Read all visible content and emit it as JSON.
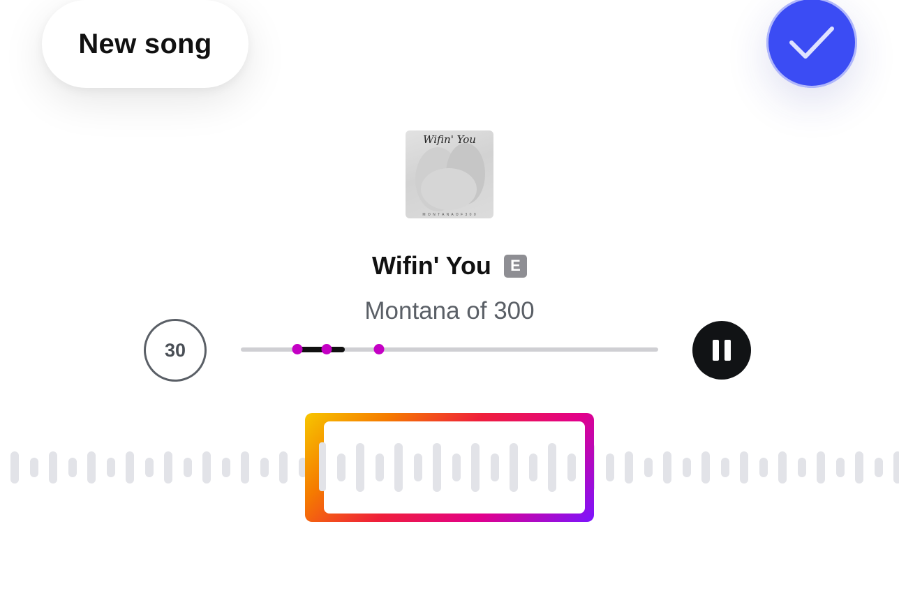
{
  "header": {
    "new_song_label": "New song",
    "done_icon": "checkmark-icon",
    "accent_color": "#3b4cf4"
  },
  "album": {
    "art_title": "Wifin' You",
    "art_credit": "M O N T A N A   O F   3 0 0"
  },
  "song": {
    "title": "Wifin' You",
    "explicit_badge": "E",
    "artist": "Montana of 300"
  },
  "player": {
    "duration_label": "30",
    "playback_state": "playing",
    "pause_icon": "pause-icon",
    "progress": {
      "selection_start_fraction": 0.135,
      "selection_end_fraction": 0.25,
      "markers_fraction": [
        0.135,
        0.205,
        0.331
      ]
    },
    "marker_color": "#c400c4"
  },
  "trimmer": {
    "gradient_colors": [
      "#f7c600",
      "#f57a00",
      "#ef1f3a",
      "#e2008a",
      "#7a14ff"
    ],
    "waveform_heights": [
      0.62,
      0.38,
      0.62,
      0.38,
      0.62,
      0.38,
      0.62,
      0.38,
      0.62,
      0.38,
      0.62,
      0.38,
      0.62,
      0.38,
      0.62,
      0.38,
      0.94,
      0.54,
      0.94,
      0.54,
      0.94,
      0.54,
      0.94,
      0.54,
      0.94,
      0.54,
      0.94,
      0.54,
      0.94,
      0.54,
      0.94,
      0.54,
      0.62,
      0.38,
      0.62,
      0.38,
      0.62,
      0.38,
      0.62,
      0.38,
      0.62,
      0.38,
      0.62,
      0.38,
      0.62,
      0.38,
      0.62
    ]
  }
}
